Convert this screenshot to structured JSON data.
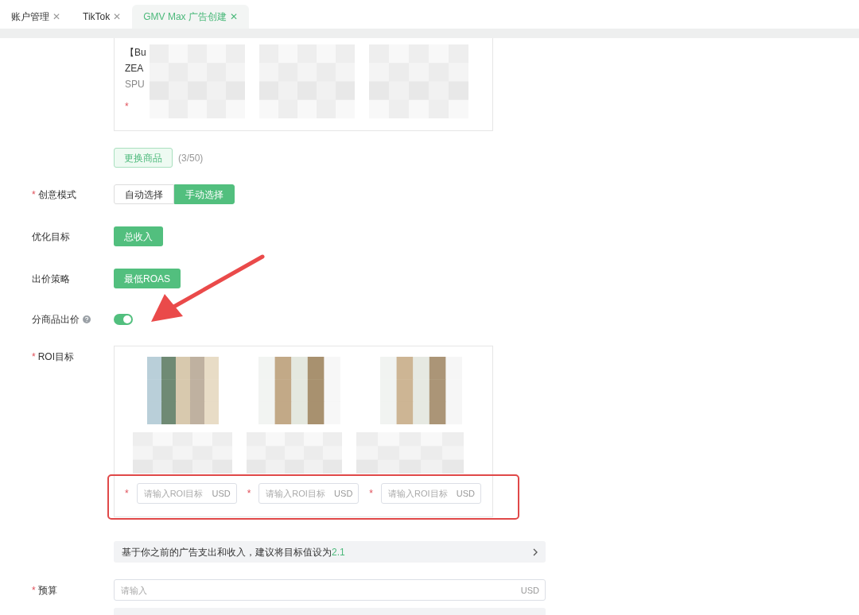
{
  "tabs": [
    {
      "label": "账户管理",
      "close": "✕",
      "selected": false
    },
    {
      "label": "TikTok",
      "close": "✕",
      "selected": false
    },
    {
      "label": "GMV Max 广告创建",
      "close": "✕",
      "selected": true
    }
  ],
  "product_card": {
    "texts": [
      "【Bu",
      "ZEA",
      "SPU"
    ],
    "required_mark": "*"
  },
  "replace": {
    "button": "更换商品",
    "count": "(3/50)"
  },
  "fields": [
    {
      "kind": "segmented",
      "label": "创意模式",
      "required_mark": "*",
      "options": [
        {
          "label": "自动选择",
          "selected": false
        },
        {
          "label": "手动选择",
          "selected": true
        }
      ]
    },
    {
      "kind": "button",
      "label": "优化目标",
      "value": "总收入"
    },
    {
      "kind": "button",
      "label": "出价策略",
      "value": "最低ROAS"
    },
    {
      "kind": "toggle",
      "label": "分商品出价",
      "help": true,
      "on": true
    }
  ],
  "roi": {
    "label": "ROI目标",
    "required_mark": "*",
    "products": [
      {
        "required_mark": "*",
        "placeholder": "请输入ROI目标",
        "unit": "USD"
      },
      {
        "required_mark": "*",
        "placeholder": "请输入ROI目标",
        "unit": "USD"
      },
      {
        "required_mark": "*",
        "placeholder": "请输入ROI目标",
        "unit": "USD"
      }
    ]
  },
  "hint": {
    "text": "基于你之前的广告支出和收入，建议将目标值设为",
    "value": "2.1"
  },
  "budget": {
    "label": "预算",
    "required_mark": "*",
    "placeholder": "请输入",
    "unit": "USD"
  }
}
